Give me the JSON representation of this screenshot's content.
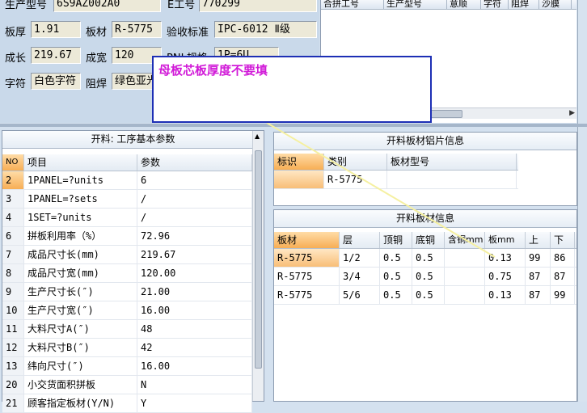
{
  "header": {
    "production_model_label": "生产型号",
    "production_model_value": "6S9AZ002A0",
    "eng_no_label": "E工号",
    "eng_no_value": "770299",
    "thickness_label": "板厚",
    "thickness_value": "1.91",
    "material_label": "板材",
    "material_value": "R-5775",
    "acceptance_label": "验收标准",
    "acceptance_value": "IPC-6012 Ⅱ级",
    "length_label": "成长",
    "length_value": "219.67",
    "width_label": "成宽",
    "width_value": "120",
    "pnl_label": "PNL规格",
    "pnl_value": "1P=6U",
    "char_label": "字符",
    "char_value": "白色字符",
    "mask_label": "阻焊",
    "mask_value": "绿色亚光"
  },
  "merge_grid": {
    "columns": [
      "合拼工号",
      "生产型号",
      "意顺",
      "字符",
      "阻焊",
      "沙膜"
    ]
  },
  "note": {
    "text": "母板芯板厚度不要填"
  },
  "left_panel": {
    "title": "开料: 工序基本参数",
    "columns": [
      "NO",
      "项目",
      "参数"
    ],
    "rows": [
      {
        "no": "2",
        "item": "1PANEL=?units",
        "value": "6"
      },
      {
        "no": "3",
        "item": "1PANEL=?sets",
        "value": "/"
      },
      {
        "no": "4",
        "item": "1SET=?units",
        "value": "/"
      },
      {
        "no": "6",
        "item": "拼板利用率（%）",
        "value": "72.96"
      },
      {
        "no": "7",
        "item": "成品尺寸长(mm)",
        "value": "219.67"
      },
      {
        "no": "8",
        "item": "成品尺寸宽(mm)",
        "value": "120.00"
      },
      {
        "no": "9",
        "item": "生产尺寸长(″)",
        "value": "21.00"
      },
      {
        "no": "10",
        "item": "生产尺寸宽(″)",
        "value": "16.00"
      },
      {
        "no": "11",
        "item": "大料尺寸A(″)",
        "value": "48"
      },
      {
        "no": "12",
        "item": "大料尺寸B(″)",
        "value": "42"
      },
      {
        "no": "13",
        "item": "纬向尺寸(″)",
        "value": "16.00"
      },
      {
        "no": "20",
        "item": "小交货面积拼板",
        "value": "N"
      },
      {
        "no": "21",
        "item": "顾客指定板材(Y/N)",
        "value": "Y"
      }
    ]
  },
  "al_panel": {
    "title": "开料板材铝片信息",
    "columns": [
      "标识",
      "类别",
      "板材型号"
    ],
    "rows": [
      {
        "mark": "",
        "category": "R-5775",
        "model": ""
      }
    ]
  },
  "sheet_panel": {
    "title": "开料板材信息",
    "columns": [
      "板材",
      "层",
      "顶铜",
      "底铜",
      "含铜mm",
      "板mm",
      "上",
      "下"
    ],
    "rows": [
      {
        "material": "R-5775",
        "layer": "1/2",
        "top": "0.5",
        "bottom": "0.5",
        "cu": "",
        "board": "0.13",
        "up": "99",
        "down": "86"
      },
      {
        "material": "R-5775",
        "layer": "3/4",
        "top": "0.5",
        "bottom": "0.5",
        "cu": "",
        "board": "0.75",
        "up": "87",
        "down": "87"
      },
      {
        "material": "R-5775",
        "layer": "5/6",
        "top": "0.5",
        "bottom": "0.5",
        "cu": "",
        "board": "0.13",
        "up": "87",
        "down": "99"
      }
    ]
  },
  "colors": {
    "note_text": "#d11ad8",
    "note_border": "#1d2fb5",
    "selected_orange": "#f7ae55",
    "arrow_line": "#f5f0a0"
  }
}
